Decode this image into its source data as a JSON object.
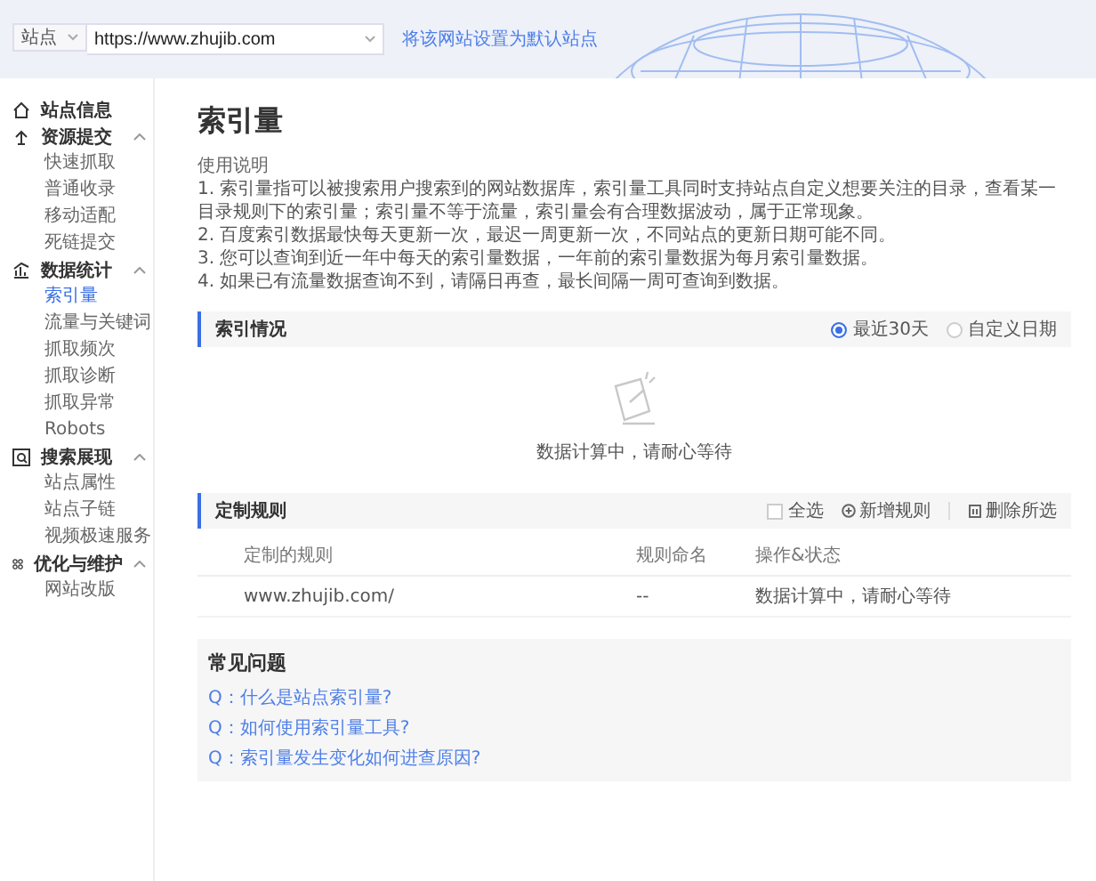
{
  "topbar": {
    "site_label": "站点",
    "url": "https://www.zhujib.com",
    "set_default_link": "将该网站设置为默认站点"
  },
  "sidebar": {
    "groups": [
      {
        "label": "站点信息"
      },
      {
        "label": "资源提交",
        "expanded": true,
        "children": [
          {
            "label": "快速抓取",
            "selected": false
          },
          {
            "label": "普通收录",
            "selected": false
          },
          {
            "label": "移动适配",
            "selected": false
          },
          {
            "label": "死链提交",
            "selected": false
          }
        ]
      },
      {
        "label": "数据统计",
        "expanded": true,
        "children": [
          {
            "label": "索引量",
            "selected": true
          },
          {
            "label": "流量与关键词",
            "selected": false
          },
          {
            "label": "抓取频次",
            "selected": false
          },
          {
            "label": "抓取诊断",
            "selected": false
          },
          {
            "label": "抓取异常",
            "selected": false
          },
          {
            "label": "Robots",
            "selected": false
          }
        ]
      },
      {
        "label": "搜索展现",
        "expanded": true,
        "children": [
          {
            "label": "站点属性",
            "selected": false
          },
          {
            "label": "站点子链",
            "selected": false
          },
          {
            "label": "视频极速服务",
            "selected": false
          }
        ]
      },
      {
        "label": "优化与维护",
        "expanded": true,
        "children": [
          {
            "label": "网站改版",
            "selected": false
          }
        ]
      }
    ]
  },
  "page": {
    "title": "索引量",
    "usage_label": "使用说明",
    "notes": [
      "1. 索引量指可以被搜索用户搜索到的网站数据库，索引量工具同时支持站点自定义想要关注的目录，查看某一目录规则下的索引量；索引量不等于流量，索引量会有合理数据波动，属于正常现象。",
      "2. 百度索引数据最快每天更新一次，最迟一周更新一次，不同站点的更新日期可能不同。",
      "3. 您可以查询到近一年中每天的索引量数据，一年前的索引量数据为每月索引量数据。",
      "4. 如果已有流量数据查询不到，请隔日再查，最长间隔一周可查询到数据。"
    ]
  },
  "index_status": {
    "title": "索引情况",
    "ranges": [
      {
        "label": "最近30天",
        "selected": true
      },
      {
        "label": "自定义日期",
        "selected": false
      }
    ],
    "empty_message": "数据计算中，请耐心等待"
  },
  "custom_rules": {
    "title": "定制规则",
    "select_all": {
      "label": "全选",
      "checked": false
    },
    "add_button": "新增规则",
    "delete_button": "删除所选",
    "columns": [
      "定制的规则",
      "规则命名",
      "操作&状态"
    ],
    "rows": [
      [
        "www.zhujib.com/",
        "--",
        "数据计算中，请耐心等待"
      ]
    ]
  },
  "faq": {
    "title": "常见问题",
    "questions": [
      "Q：什么是站点索引量?",
      "Q：如何使用索引量工具?",
      "Q：索引量发生变化如何进查原因?"
    ]
  }
}
